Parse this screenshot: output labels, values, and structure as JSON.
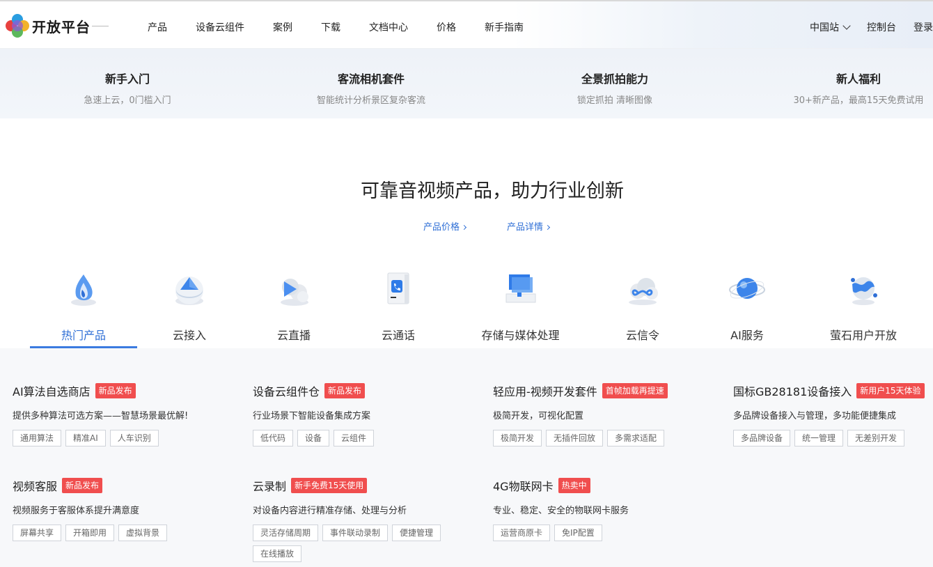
{
  "header": {
    "logo_text": "开放平台",
    "nav": [
      "产品",
      "设备云组件",
      "案例",
      "下载",
      "文档中心",
      "价格",
      "新手指南"
    ],
    "region": "中国站",
    "console": "控制台",
    "login": "登录"
  },
  "strip": [
    {
      "title": "新手入门",
      "subtitle": "急速上云，0门槛入门"
    },
    {
      "title": "客流相机套件",
      "subtitle": "智能统计分析景区复杂客流"
    },
    {
      "title": "全景抓拍能力",
      "subtitle": "锁定抓拍 清晰图像"
    },
    {
      "title": "新人福利",
      "subtitle": "30+新产品，最高15天免费试用"
    }
  ],
  "hero": {
    "title": "可靠音视频产品，助力行业创新",
    "link_price": "产品价格",
    "link_detail": "产品详情"
  },
  "categories": [
    {
      "label": "热门产品",
      "icon": "flame-icon",
      "active": true
    },
    {
      "label": "云接入",
      "icon": "cloud-access-icon"
    },
    {
      "label": "云直播",
      "icon": "cloud-live-icon"
    },
    {
      "label": "云通话",
      "icon": "phone-icon"
    },
    {
      "label": "存储与媒体处理",
      "icon": "storage-icon"
    },
    {
      "label": "云信令",
      "icon": "cloud-signal-icon"
    },
    {
      "label": "AI服务",
      "icon": "ai-globe-icon"
    },
    {
      "label": "萤石用户开放",
      "icon": "user-open-icon"
    }
  ],
  "products": [
    {
      "title": "AI算法自选商店",
      "badge": "新品发布",
      "desc": "提供多种算法可选方案——智慧场景最优解!",
      "tags": [
        "通用算法",
        "精准AI",
        "人车识别"
      ]
    },
    {
      "title": "设备云组件仓",
      "badge": "新品发布",
      "desc": "行业场景下智能设备集成方案",
      "tags": [
        "低代码",
        "设备",
        "云组件"
      ]
    },
    {
      "title": "轻应用-视频开发套件",
      "badge": "首帧加载再提速",
      "desc": "极简开发，可视化配置",
      "tags": [
        "极简开发",
        "无插件回放",
        "多需求适配"
      ]
    },
    {
      "title": "国标GB28181设备接入",
      "badge": "新用户15天体验",
      "desc": "多品牌设备接入与管理，多功能便捷集成",
      "tags": [
        "多品牌设备",
        "统一管理",
        "无差别开发"
      ]
    },
    {
      "title": "视频客服",
      "badge": "新品发布",
      "desc": "视频服务于客服体系提升满意度",
      "tags": [
        "屏幕共享",
        "开箱即用",
        "虚拟背景"
      ]
    },
    {
      "title": "云录制",
      "badge": "新手免费15天使用",
      "desc": "对设备内容进行精准存储、处理与分析",
      "tags": [
        "灵活存储周期",
        "事件联动录制",
        "便捷管理",
        "在线播放"
      ]
    },
    {
      "title": "4G物联网卡",
      "badge": "热卖中",
      "desc": "专业、稳定、安全的物联网卡服务",
      "tags": [
        "运营商原卡",
        "免IP配置"
      ]
    }
  ],
  "colors": {
    "accent": "#2f6fd6",
    "badge": "#f04e4e",
    "grid_bg": "#f7f8fa"
  }
}
